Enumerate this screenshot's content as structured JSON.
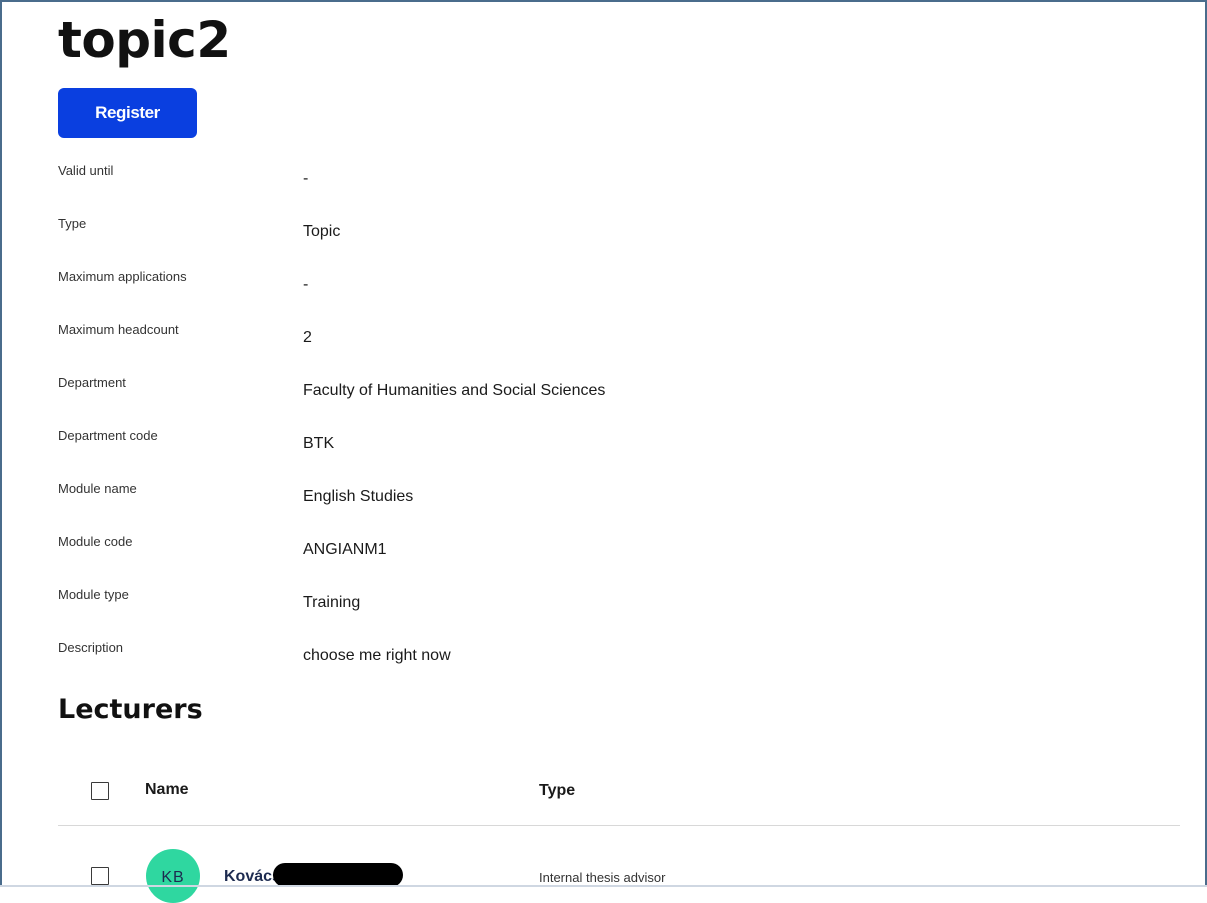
{
  "page": {
    "title": "topic2"
  },
  "actions": {
    "register_label": "Register"
  },
  "details": [
    {
      "label": "Valid until",
      "value": "-"
    },
    {
      "label": "Type",
      "value": "Topic"
    },
    {
      "label": "Maximum applications",
      "value": "-"
    },
    {
      "label": "Maximum headcount",
      "value": "2"
    },
    {
      "label": "Department",
      "value": "Faculty of Humanities and Social Sciences"
    },
    {
      "label": "Department code",
      "value": "BTK"
    },
    {
      "label": "Module name",
      "value": "English Studies"
    },
    {
      "label": "Module code",
      "value": "ANGIANM1"
    },
    {
      "label": "Module type",
      "value": "Training"
    },
    {
      "label": "Description",
      "value": "choose me right now"
    }
  ],
  "lecturers": {
    "heading": "Lecturers",
    "columns": {
      "name": "Name",
      "type": "Type"
    },
    "rows": [
      {
        "initials": "KB",
        "name": "Kovács",
        "type": "Internal thesis advisor"
      }
    ]
  },
  "colors": {
    "primary_button": "#0a3fe0",
    "avatar_bg": "#2fd7a0",
    "name_text": "#1d2b50"
  },
  "icons": {
    "select_all": "checkbox-icon",
    "row_select": "checkbox-icon"
  }
}
